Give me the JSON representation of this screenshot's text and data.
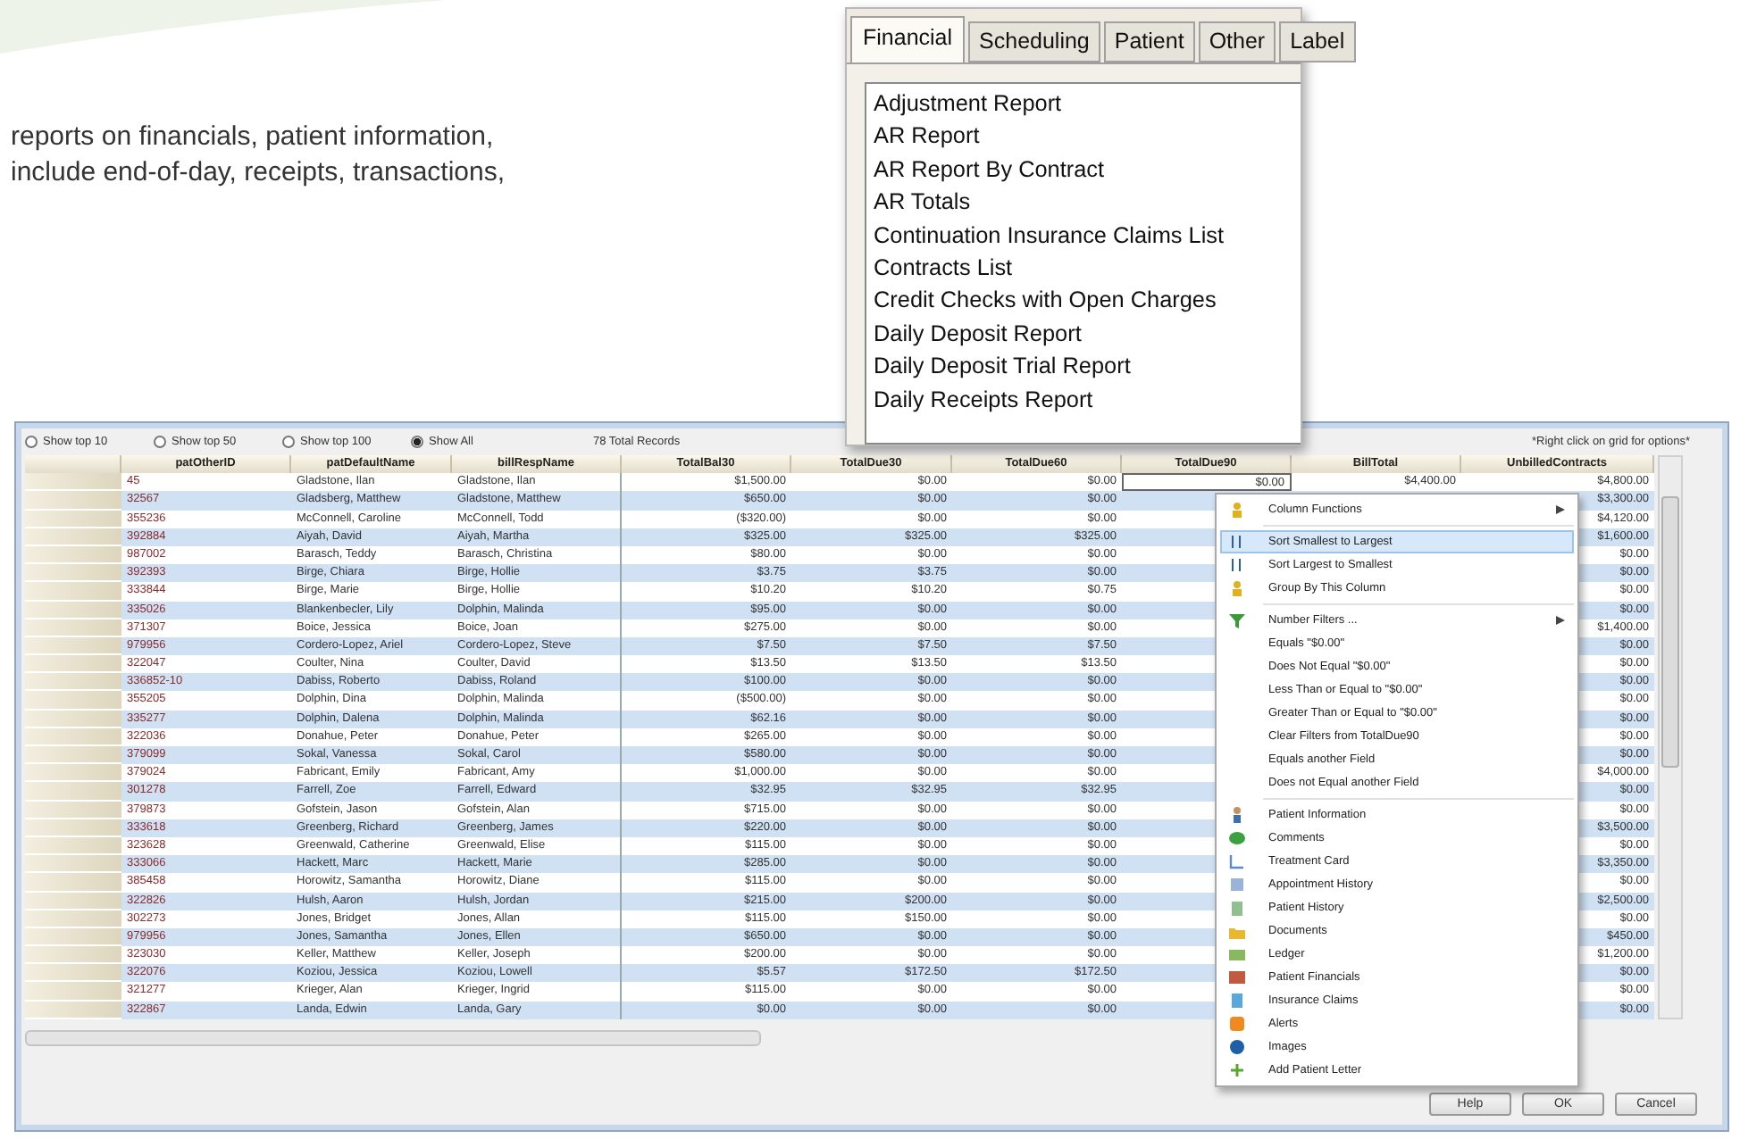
{
  "intro_text": [
    "reports on financials, patient information,",
    "include end-of-day, receipts, transactions,"
  ],
  "report_window": {
    "tabs": [
      {
        "label": "Financial",
        "selected": true
      },
      {
        "label": "Scheduling",
        "selected": false
      },
      {
        "label": "Patient",
        "selected": false
      },
      {
        "label": "Other",
        "selected": false
      },
      {
        "label": "Label",
        "selected": false
      }
    ],
    "reports": [
      "Adjustment Report",
      "AR Report",
      "AR Report By Contract",
      "AR Totals",
      "Continuation Insurance Claims List",
      "Contracts List",
      "Credit Checks with Open Charges",
      "Daily Deposit Report",
      "Daily Deposit Trial Report",
      "Daily Receipts Report"
    ]
  },
  "grid_window": {
    "show_options": [
      {
        "label": "Show top 10",
        "selected": false
      },
      {
        "label": "Show top 50",
        "selected": false
      },
      {
        "label": "Show top 100",
        "selected": false
      },
      {
        "label": "Show All",
        "selected": true
      }
    ],
    "total_records": "78 Total Records",
    "hint": "*Right click on grid for options*",
    "columns": [
      "patOtherID",
      "patDefaultName",
      "billRespName",
      "TotalBal30",
      "TotalDue30",
      "TotalDue60",
      "TotalDue90",
      "BillTotal",
      "UnbilledContracts"
    ],
    "rows": [
      {
        "cells": [
          "45",
          "Gladstone, Ilan",
          "Gladstone, Ilan",
          "$1,500.00",
          "$0.00",
          "$0.00",
          "$0.00",
          "$4,400.00",
          "$4,800.00"
        ]
      },
      {
        "cells": [
          "32567",
          "Gladsberg, Matthew",
          "Gladstone, Matthew",
          "$650.00",
          "$0.00",
          "$0.00"
        ],
        "unbilled": "$3,300.00"
      },
      {
        "cells": [
          "355236",
          "McConnell, Caroline",
          "McConnell, Todd",
          "($320.00)",
          "$0.00",
          "$0.00"
        ],
        "unbilled": "$4,120.00"
      },
      {
        "cells": [
          "392884",
          "Aiyah, David",
          "Aiyah, Martha",
          "$325.00",
          "$325.00",
          "$325.00"
        ],
        "unbilled": "$1,600.00"
      },
      {
        "cells": [
          "987002",
          "Barasch, Teddy",
          "Barasch, Christina",
          "$80.00",
          "$0.00",
          "$0.00"
        ],
        "unbilled": "$0.00"
      },
      {
        "cells": [
          "392393",
          "Birge, Chiara",
          "Birge, Hollie",
          "$3.75",
          "$3.75",
          "$0.00"
        ],
        "unbilled": "$0.00"
      },
      {
        "cells": [
          "333844",
          "Birge, Marie",
          "Birge, Hollie",
          "$10.20",
          "$10.20",
          "$0.75"
        ],
        "unbilled": "$0.00"
      },
      {
        "cells": [
          "335026",
          "Blankenbecler, Lily",
          "Dolphin, Malinda",
          "$95.00",
          "$0.00",
          "$0.00"
        ],
        "unbilled": "$0.00"
      },
      {
        "cells": [
          "371307",
          "Boice, Jessica",
          "Boice, Joan",
          "$275.00",
          "$0.00",
          "$0.00"
        ],
        "unbilled": "$1,400.00"
      },
      {
        "cells": [
          "979956",
          "Cordero-Lopez, Ariel",
          "Cordero-Lopez, Steve",
          "$7.50",
          "$7.50",
          "$7.50"
        ],
        "unbilled": "$0.00"
      },
      {
        "cells": [
          "322047",
          "Coulter, Nina",
          "Coulter, David",
          "$13.50",
          "$13.50",
          "$13.50"
        ],
        "unbilled": "$0.00"
      },
      {
        "cells": [
          "336852-10",
          "Dabiss, Roberto",
          "Dabiss, Roland",
          "$100.00",
          "$0.00",
          "$0.00"
        ],
        "unbilled": "$0.00"
      },
      {
        "cells": [
          "355205",
          "Dolphin, Dina",
          "Dolphin, Malinda",
          "($500.00)",
          "$0.00",
          "$0.00"
        ],
        "unbilled": "$0.00"
      },
      {
        "cells": [
          "335277",
          "Dolphin, Dalena",
          "Dolphin, Malinda",
          "$62.16",
          "$0.00",
          "$0.00"
        ],
        "unbilled": "$0.00"
      },
      {
        "cells": [
          "322036",
          "Donahue, Peter",
          "Donahue, Peter",
          "$265.00",
          "$0.00",
          "$0.00"
        ],
        "unbilled": "$0.00"
      },
      {
        "cells": [
          "379099",
          "Sokal, Vanessa",
          "Sokal, Carol",
          "$580.00",
          "$0.00",
          "$0.00"
        ],
        "unbilled": "$0.00"
      },
      {
        "cells": [
          "379024",
          "Fabricant, Emily",
          "Fabricant, Amy",
          "$1,000.00",
          "$0.00",
          "$0.00"
        ],
        "unbilled": "$4,000.00"
      },
      {
        "cells": [
          "301278",
          "Farrell, Zoe",
          "Farrell, Edward",
          "$32.95",
          "$32.95",
          "$32.95"
        ],
        "unbilled": "$0.00"
      },
      {
        "cells": [
          "379873",
          "Gofstein, Jason",
          "Gofstein, Alan",
          "$715.00",
          "$0.00",
          "$0.00"
        ],
        "unbilled": "$0.00"
      },
      {
        "cells": [
          "333618",
          "Greenberg, Richard",
          "Greenberg, James",
          "$220.00",
          "$0.00",
          "$0.00"
        ],
        "unbilled": "$3,500.00"
      },
      {
        "cells": [
          "323628",
          "Greenwald, Catherine",
          "Greenwald, Elise",
          "$115.00",
          "$0.00",
          "$0.00"
        ],
        "unbilled": "$0.00"
      },
      {
        "cells": [
          "333066",
          "Hackett, Marc",
          "Hackett, Marie",
          "$285.00",
          "$0.00",
          "$0.00"
        ],
        "unbilled": "$3,350.00"
      },
      {
        "cells": [
          "385458",
          "Horowitz, Samantha",
          "Horowitz, Diane",
          "$115.00",
          "$0.00",
          "$0.00"
        ],
        "unbilled": "$0.00"
      },
      {
        "cells": [
          "322826",
          "Hulsh, Aaron",
          "Hulsh, Jordan",
          "$215.00",
          "$200.00",
          "$0.00"
        ],
        "unbilled": "$2,500.00"
      },
      {
        "cells": [
          "302273",
          "Jones, Bridget",
          "Jones, Allan",
          "$115.00",
          "$150.00",
          "$0.00"
        ],
        "unbilled": "$0.00"
      },
      {
        "cells": [
          "979956",
          "Jones, Samantha",
          "Jones, Ellen",
          "$650.00",
          "$0.00",
          "$0.00"
        ],
        "unbilled": "$450.00"
      },
      {
        "cells": [
          "323030",
          "Keller, Matthew",
          "Keller, Joseph",
          "$200.00",
          "$0.00",
          "$0.00"
        ],
        "unbilled": "$1,200.00"
      },
      {
        "cells": [
          "322076",
          "Koziou, Jessica",
          "Koziou, Lowell",
          "$5.57",
          "$172.50",
          "$172.50"
        ],
        "unbilled": "$0.00"
      },
      {
        "cells": [
          "321277",
          "Krieger, Alan",
          "Krieger, Ingrid",
          "$115.00",
          "$0.00",
          "$0.00"
        ],
        "unbilled": "$0.00"
      },
      {
        "cells": [
          "322867",
          "Landa, Edwin",
          "Landa, Gary",
          "$0.00",
          "$0.00",
          "$0.00"
        ],
        "unbilled": "$0.00"
      }
    ],
    "buttons": [
      "Help",
      "OK",
      "Cancel"
    ]
  },
  "context_menu": [
    {
      "kind": "submenu",
      "label": "Column Functions",
      "selected": false
    },
    {
      "kind": "separator"
    },
    {
      "kind": "command",
      "label": "Sort Smallest to Largest",
      "selected": true
    },
    {
      "kind": "command",
      "label": "Sort Largest to Smallest",
      "selected": false
    },
    {
      "kind": "command",
      "label": "Group By This Column",
      "selected": false
    },
    {
      "kind": "separator"
    },
    {
      "kind": "submenu",
      "label": "Number Filters ...",
      "selected": false
    },
    {
      "kind": "command",
      "label": "Equals \"$0.00\"",
      "selected": false
    },
    {
      "kind": "command",
      "label": "Does Not Equal \"$0.00\"",
      "selected": false
    },
    {
      "kind": "command",
      "label": "Less Than or Equal to \"$0.00\"",
      "selected": false
    },
    {
      "kind": "command",
      "label": "Greater Than or Equal to \"$0.00\"",
      "selected": false
    },
    {
      "kind": "command",
      "label": "Clear Filters from TotalDue90",
      "selected": false
    },
    {
      "kind": "command",
      "label": "Equals another Field",
      "selected": false
    },
    {
      "kind": "command",
      "label": "Does not Equal another Field",
      "selected": false
    },
    {
      "kind": "separator"
    },
    {
      "kind": "command",
      "label": "Patient Information",
      "selected": false
    },
    {
      "kind": "command",
      "label": "Comments",
      "selected": false
    },
    {
      "kind": "command",
      "label": "Treatment Card",
      "selected": false
    },
    {
      "kind": "command",
      "label": "Appointment History",
      "selected": false
    },
    {
      "kind": "command",
      "label": "Patient History",
      "selected": false
    },
    {
      "kind": "command",
      "label": "Documents",
      "selected": false
    },
    {
      "kind": "command",
      "label": "Ledger",
      "selected": false
    },
    {
      "kind": "command",
      "label": "Patient Financials",
      "selected": false
    },
    {
      "kind": "command",
      "label": "Insurance Claims",
      "selected": false
    },
    {
      "kind": "command",
      "label": "Alerts",
      "selected": false
    },
    {
      "kind": "command",
      "label": "Images",
      "selected": false
    },
    {
      "kind": "command",
      "label": "Add Patient Letter",
      "selected": false
    }
  ]
}
